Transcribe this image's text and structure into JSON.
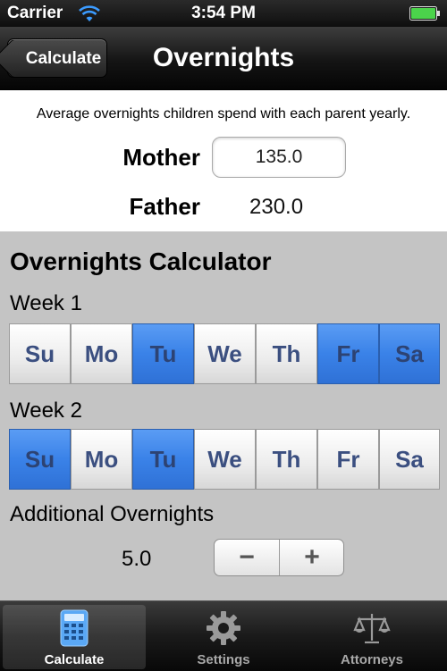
{
  "status_bar": {
    "carrier": "Carrier",
    "time": "3:54 PM"
  },
  "nav": {
    "back_label": "Calculate",
    "title": "Overnights"
  },
  "info": {
    "description": "Average overnights children spend with each parent yearly.",
    "mother_label": "Mother",
    "mother_value": "135.0",
    "father_label": "Father",
    "father_value": "230.0"
  },
  "calculator": {
    "title": "Overnights Calculator",
    "week1_label": "Week 1",
    "week2_label": "Week 2",
    "week1_days": [
      {
        "label": "Su",
        "selected": false
      },
      {
        "label": "Mo",
        "selected": false
      },
      {
        "label": "Tu",
        "selected": true
      },
      {
        "label": "We",
        "selected": false
      },
      {
        "label": "Th",
        "selected": false
      },
      {
        "label": "Fr",
        "selected": true
      },
      {
        "label": "Sa",
        "selected": true
      }
    ],
    "week2_days": [
      {
        "label": "Su",
        "selected": true
      },
      {
        "label": "Mo",
        "selected": false
      },
      {
        "label": "Tu",
        "selected": true
      },
      {
        "label": "We",
        "selected": false
      },
      {
        "label": "Th",
        "selected": false
      },
      {
        "label": "Fr",
        "selected": false
      },
      {
        "label": "Sa",
        "selected": false
      }
    ],
    "additional_label": "Additional Overnights",
    "additional_value": "5.0",
    "stepper_minus": "−",
    "stepper_plus": "+"
  },
  "tabs": [
    {
      "label": "Calculate",
      "icon": "calculator-icon",
      "active": true
    },
    {
      "label": "Settings",
      "icon": "gear-icon",
      "active": false
    },
    {
      "label": "Attorneys",
      "icon": "scales-icon",
      "active": false
    }
  ],
  "colors": {
    "selected_day": "#3a82e8",
    "day_text": "#3b4f80",
    "background": "#c4c4c4"
  }
}
